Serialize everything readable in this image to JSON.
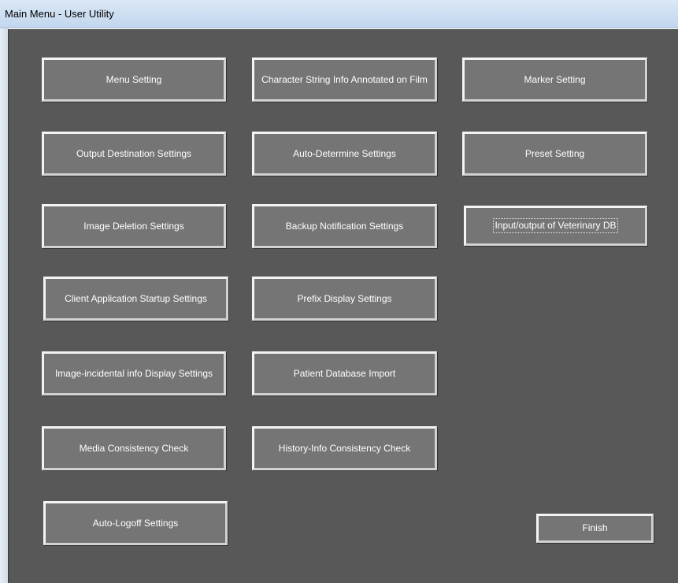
{
  "window": {
    "title": "Main Menu - User Utility"
  },
  "buttons": {
    "menu_setting": "Menu Setting",
    "character_string_info": "Character String Info Annotated on Film",
    "marker_setting": "Marker Setting",
    "output_destination_settings": "Output Destination Settings",
    "auto_determine_settings": "Auto-Determine Settings",
    "preset_setting": "Preset Setting",
    "image_deletion_settings": "Image Deletion Settings",
    "backup_notification_settings": "Backup Notification Settings",
    "input_output_veterinary_db": "Input/output of Veterinary DB",
    "client_application_startup_settings": "Client Application Startup Settings",
    "prefix_display_settings": "Prefix Display Settings",
    "image_incidental_info_display_settings": "Image-incidental info Display Settings",
    "patient_database_import": "Patient Database Import",
    "media_consistency_check": "Media Consistency Check",
    "history_info_consistency_check": "History-Info Consistency Check",
    "auto_logoff_settings": "Auto-Logoff Settings",
    "finish": "Finish"
  },
  "colors": {
    "background": "#585858",
    "button_face": "#757575",
    "button_text": "#ffffff"
  }
}
